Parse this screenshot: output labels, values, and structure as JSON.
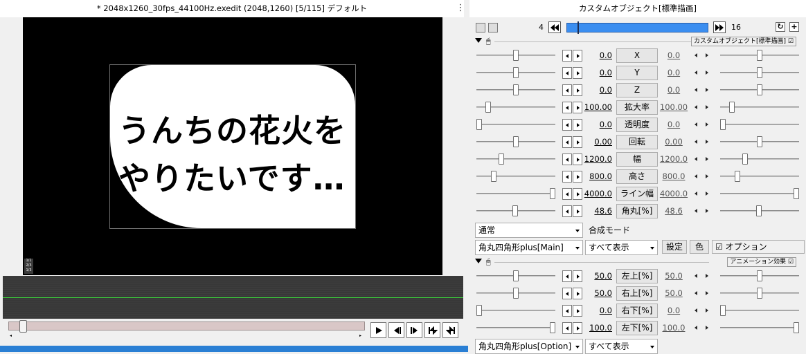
{
  "preview": {
    "title": "* 2048x1260_30fps_44100Hz.exedit (2048,1260)  [5/115]  デフォルト",
    "kebab_icon": "more-vertical-icon",
    "text_line1": "うんちの花火を",
    "text_line2": "やりたいです…",
    "badge": "1/1\n2/3\n1/3",
    "seek_value_fraction": 0.05
  },
  "dialog": {
    "title": "カスタムオブジェクト[標準描画]",
    "frame_start": "4",
    "frame_end": "16",
    "section1_tag": "カスタムオブジェクト[標準描画]",
    "section2_tag": "アニメーション効果",
    "params": [
      {
        "label": "X",
        "value": "0.0",
        "value2": "0.0",
        "pos": 0.5,
        "pos2": 0.5
      },
      {
        "label": "Y",
        "value": "0.0",
        "value2": "0.0",
        "pos": 0.5,
        "pos2": 0.5
      },
      {
        "label": "Z",
        "value": "0.0",
        "value2": "0.0",
        "pos": 0.5,
        "pos2": 0.5
      },
      {
        "label": "拡大率",
        "value": "100.00",
        "value2": "100.00",
        "pos": 0.12,
        "pos2": 0.12
      },
      {
        "label": "透明度",
        "value": "0.0",
        "value2": "0.0",
        "pos": 0.0,
        "pos2": 0.0
      },
      {
        "label": "回転",
        "value": "0.00",
        "value2": "0.00",
        "pos": 0.5,
        "pos2": 0.5
      },
      {
        "label": "幅",
        "value": "1200.0",
        "value2": "1200.0",
        "pos": 0.3,
        "pos2": 0.3
      },
      {
        "label": "高さ",
        "value": "800.0",
        "value2": "800.0",
        "pos": 0.2,
        "pos2": 0.2
      },
      {
        "label": "ライン幅",
        "value": "4000.0",
        "value2": "4000.0",
        "pos": 1.0,
        "pos2": 1.0
      },
      {
        "label": "角丸[%]",
        "value": "48.6",
        "value2": "48.6",
        "pos": 0.49,
        "pos2": 0.49
      }
    ],
    "blend_mode": "通常",
    "blend_label": "合成モード",
    "script_select": "角丸四角形plus[Main]",
    "display_select": "すべて表示",
    "settings_btn": "設定",
    "color_btn": "色",
    "option_label": "オプション",
    "anim_params": [
      {
        "label": "左上[%]",
        "value": "50.0",
        "value2": "50.0",
        "pos": 0.5,
        "pos2": 0.5
      },
      {
        "label": "右上[%]",
        "value": "50.0",
        "value2": "50.0",
        "pos": 0.5,
        "pos2": 0.5
      },
      {
        "label": "右下[%]",
        "value": "0.0",
        "value2": "0.0",
        "pos": 0.0,
        "pos2": 0.0
      },
      {
        "label": "左下[%]",
        "value": "100.0",
        "value2": "100.0",
        "pos": 1.0,
        "pos2": 1.0
      }
    ],
    "script_select2": "角丸四角形plus[Option]",
    "display_select2": "すべて表示"
  }
}
